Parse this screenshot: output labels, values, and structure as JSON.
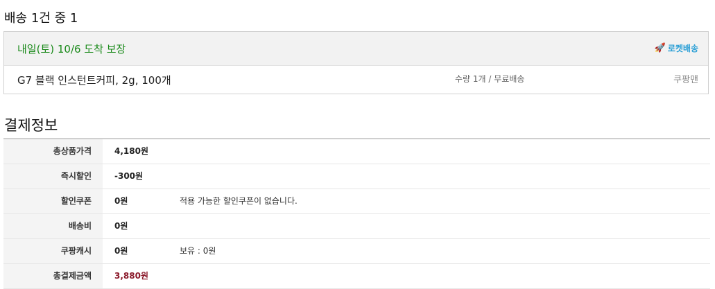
{
  "shipment": {
    "title": "배송 1건 중 1",
    "arrival": "내일(토) 10/6 도착 보장",
    "badge_label": "로켓배송",
    "badge_icon": "rocket-icon",
    "product": "G7 블랙 인스턴트커피, 2g, 100개",
    "quantity_shipping": "수량 1개 / 무료배송",
    "carrier": "쿠팡맨"
  },
  "payment": {
    "title": "결제정보",
    "rows": [
      {
        "label": "총상품가격",
        "value": "4,180원",
        "note": ""
      },
      {
        "label": "즉시할인",
        "value": "-300원",
        "note": ""
      },
      {
        "label": "할인쿠폰",
        "value": "0원",
        "note": "적용 가능한 할인쿠폰이 없습니다."
      },
      {
        "label": "배송비",
        "value": "0원",
        "note": ""
      },
      {
        "label": "쿠팡캐시",
        "value": "0원",
        "note": "보유 : 0원"
      },
      {
        "label": "총결제금액",
        "value": "3,880원",
        "note": ""
      }
    ]
  },
  "colors": {
    "arrival": "#1a8a1a",
    "badge": "#2a9fd6",
    "total": "#8b1a2b"
  }
}
